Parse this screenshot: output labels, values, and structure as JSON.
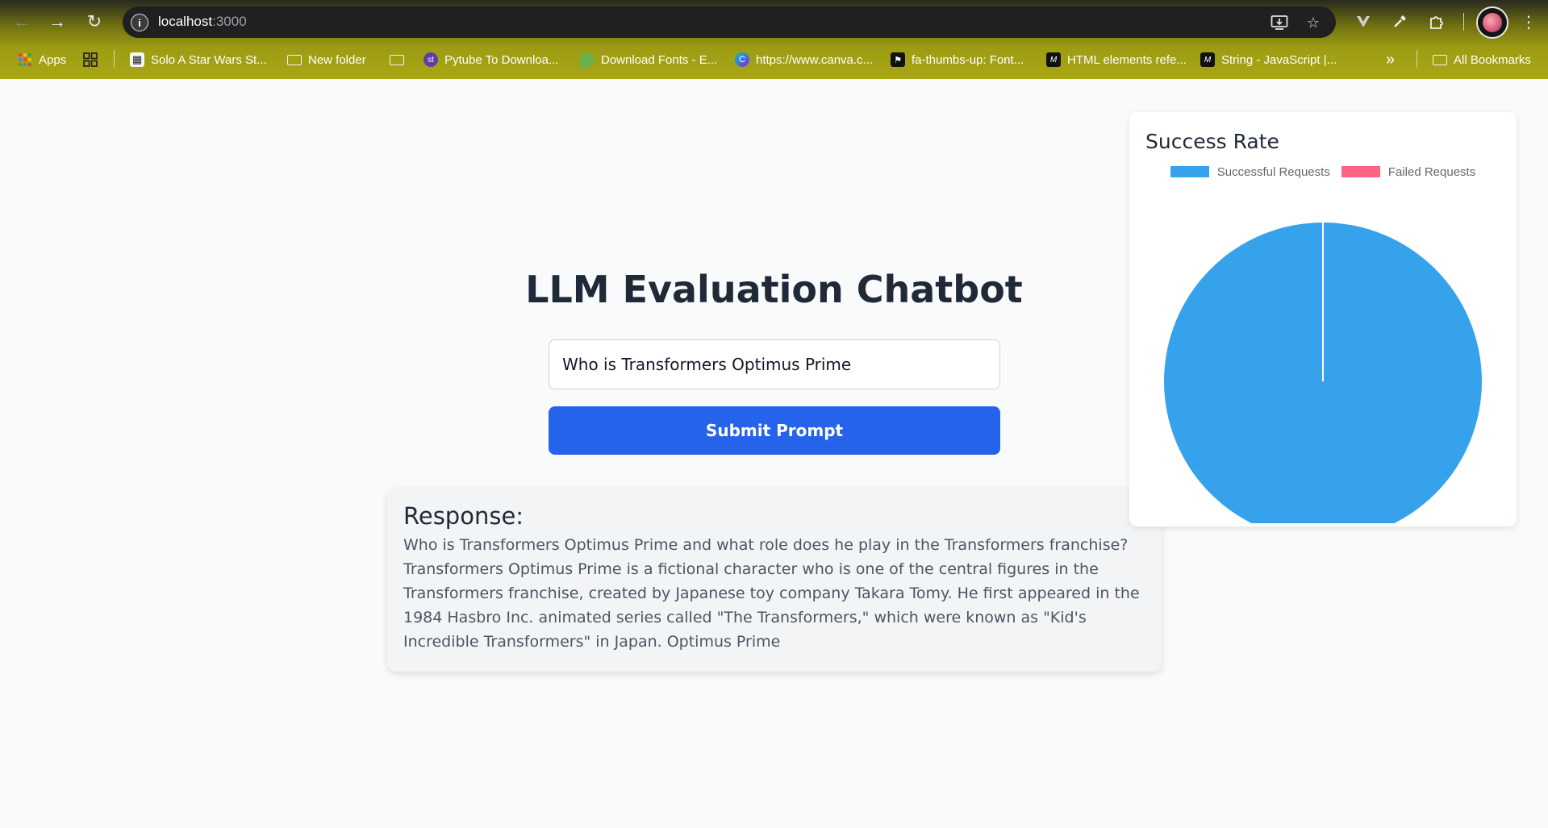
{
  "browser": {
    "url_host": "localhost",
    "url_port": ":3000",
    "bookmarks": [
      {
        "label": "Apps",
        "icon": "apps-grid-icon"
      },
      {
        "label": "",
        "icon": "tab-groups-icon"
      },
      {
        "label": "Solo A Star Wars St...",
        "icon": "site-favicon"
      },
      {
        "label": "New folder",
        "icon": "folder-icon"
      },
      {
        "label": "",
        "icon": "folder-icon"
      },
      {
        "label": "Pytube To Downloa...",
        "icon": "st-favicon"
      },
      {
        "label": "Download Fonts - E...",
        "icon": "leaf-favicon"
      },
      {
        "label": "https://www.canva.c...",
        "icon": "canva-favicon"
      },
      {
        "label": "fa-thumbs-up: Font...",
        "icon": "flag-favicon"
      },
      {
        "label": "HTML elements refe...",
        "icon": "mdn-favicon"
      },
      {
        "label": "String - JavaScript |...",
        "icon": "mdn-favicon"
      }
    ],
    "more_bookmarks": "»",
    "all_bookmarks_label": "All Bookmarks"
  },
  "page": {
    "title": "LLM Evaluation Chatbot",
    "prompt_value": "Who is Transformers Optimus Prime",
    "submit_label": "Submit Prompt",
    "response_heading": "Response:",
    "response_text": "Who is Transformers Optimus Prime and what role does he play in the Transformers franchise? Transformers Optimus Prime is a fictional character who is one of the central figures in the Transformers franchise, created by Japanese toy company Takara Tomy. He first appeared in the 1984 Hasbro Inc. animated series called \"The Transformers,\" which were known as \"Kid's Incredible Transformers\" in Japan. Optimus Prime"
  },
  "chart_data": {
    "type": "pie",
    "title": "Success Rate",
    "categories": [
      "Successful Requests",
      "Failed Requests"
    ],
    "values": [
      1,
      0
    ],
    "colors": [
      "#36a2eb",
      "#ff6384"
    ],
    "legend": "top"
  }
}
